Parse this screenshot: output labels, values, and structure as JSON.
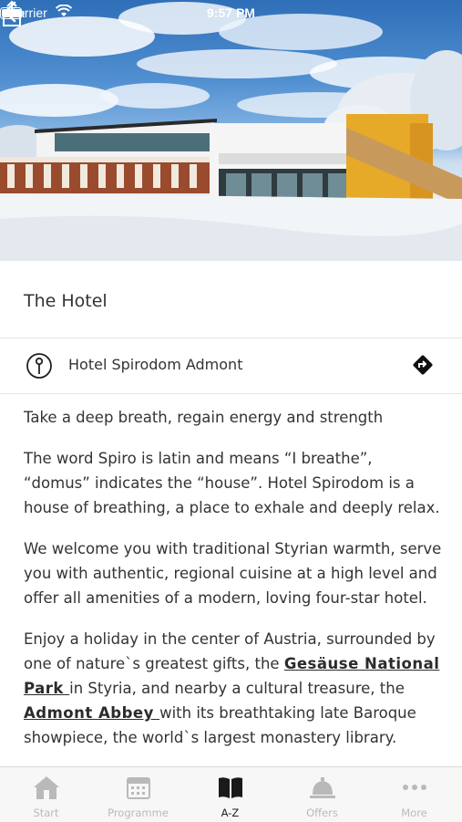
{
  "status_bar": {
    "carrier": "Carrier",
    "time": "9:57 PM"
  },
  "hero": {
    "alt": "hotel-photo-winter"
  },
  "header": {
    "title": "The Hotel"
  },
  "location": {
    "name": "Hotel Spirodom Admont",
    "icon": "map-pin-icon",
    "directions_icon": "directions-icon"
  },
  "content": {
    "p1": "Take a deep breath, regain energy and strength",
    "p2": "The word Spiro is latin and means “I breathe”, “domus” indicates the “house”. Hotel Spirodom is a house of breathing, a place to exhale and deeply relax.",
    "p3": "We welcome you with traditional Styrian warmth, serve you with authentic, regional cuisine at a high level and offer all amenities of a modern, loving four-star hotel.",
    "p4_a": "Enjoy a holiday in the center of Austria, surrounded by one of nature`s greatest gifts, the ",
    "p4_link1": "Gesäuse National Park ",
    "p4_b": "in Styria, and nearby a cultural treasure, the ",
    "p4_link2": "Admont Abbey ",
    "p4_c": " with its breathtaking late Baroque showpiece, the world`s largest monastery library."
  },
  "tabbar": {
    "tabs": [
      {
        "label": "Start",
        "icon": "home-icon"
      },
      {
        "label": "Programme",
        "icon": "calendar-icon"
      },
      {
        "label": "A-Z",
        "icon": "book-icon"
      },
      {
        "label": "Offers",
        "icon": "service-bell-icon"
      },
      {
        "label": "More",
        "icon": "more-icon"
      }
    ],
    "active": "A-Z",
    "active_color": "#222222",
    "inactive_color": "#b9b9b9"
  }
}
